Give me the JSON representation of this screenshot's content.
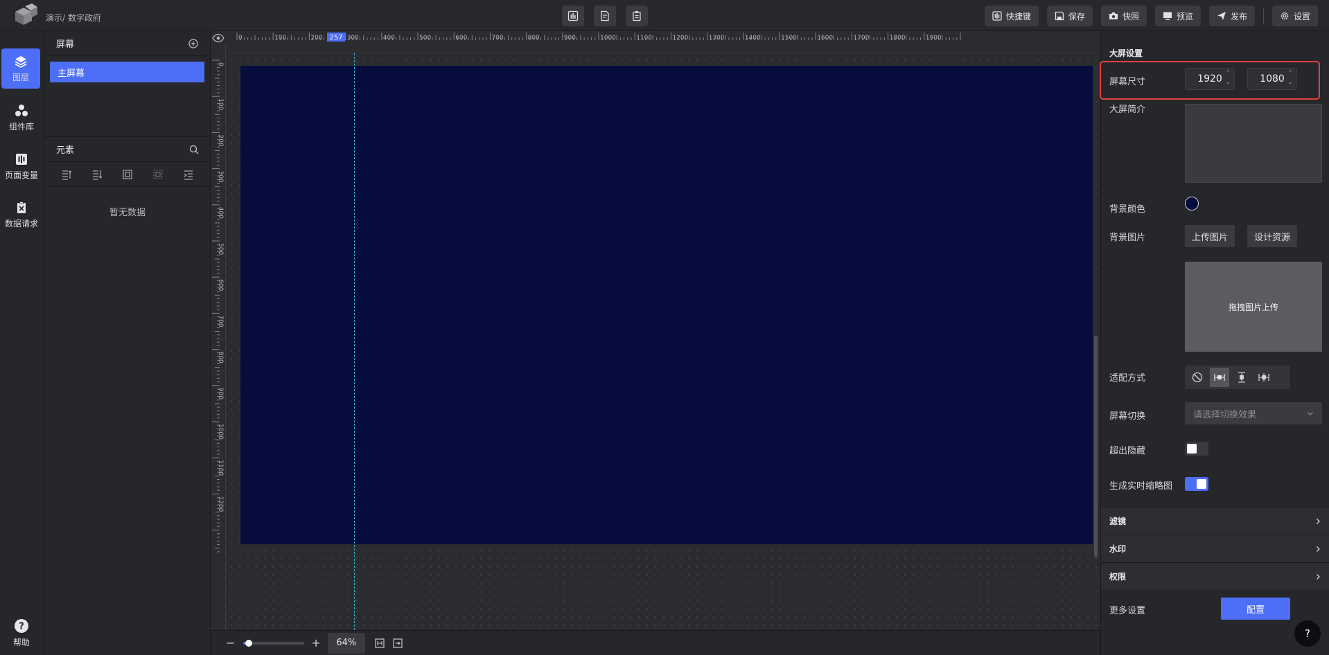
{
  "header": {
    "breadcrumb": "演示/ 数字政府",
    "buttons": {
      "shortcuts": "快捷键",
      "save": "保存",
      "snapshot": "快照",
      "preview": "预览",
      "publish": "发布",
      "settings": "设置"
    }
  },
  "leftnav": {
    "items": [
      {
        "label": "图层",
        "icon": "layers-icon"
      },
      {
        "label": "组件库",
        "icon": "components-icon"
      },
      {
        "label": "页面变量",
        "icon": "variables-icon"
      },
      {
        "label": "数据请求",
        "icon": "data-request-icon"
      }
    ],
    "help": "帮助"
  },
  "screens_panel": {
    "title": "屏幕",
    "items": [
      "主屏幕"
    ]
  },
  "elements_panel": {
    "title": "元素",
    "empty": "暂无数据"
  },
  "canvas": {
    "ruler_marker": "257",
    "ruler_top_ticks": [
      "0",
      "100",
      "200",
      "300",
      "400",
      "500",
      "600",
      "700",
      "800",
      "900",
      "1000",
      "1100",
      "1200",
      "1300",
      "1400",
      "1500",
      "1600",
      "1700",
      "1800",
      "1900"
    ],
    "ruler_left_ticks": [
      "0",
      "100",
      "200",
      "300",
      "400",
      "500",
      "600",
      "700",
      "800",
      "900",
      "1000",
      "1100",
      "1200"
    ],
    "background_color": "#060c3c",
    "zoom": "64%",
    "zoom_level": 0.09
  },
  "settings": {
    "title": "大屏设置",
    "screen_size_label": "屏幕尺寸",
    "width": "1920",
    "height": "1080",
    "intro_label": "大屏简介",
    "bg_color_label": "背景颜色",
    "bg_image_label": "背景图片",
    "upload_label": "上传图片",
    "design_resource_label": "设计资源",
    "drag_upload": "拖拽图片上传",
    "fit_label": "适配方式",
    "switch_label": "屏幕切换",
    "switch_placeholder": "请选择切换效果",
    "overflow_label": "超出隐藏",
    "overflow_on": false,
    "thumbnail_label": "生成实时缩略图",
    "thumbnail_on": true,
    "sections": [
      "滤镜",
      "水印",
      "权限"
    ],
    "more_label": "更多设置",
    "config_label": "配置"
  },
  "colors": {
    "accent": "#4d6ef6",
    "highlight": "#e5403d"
  }
}
